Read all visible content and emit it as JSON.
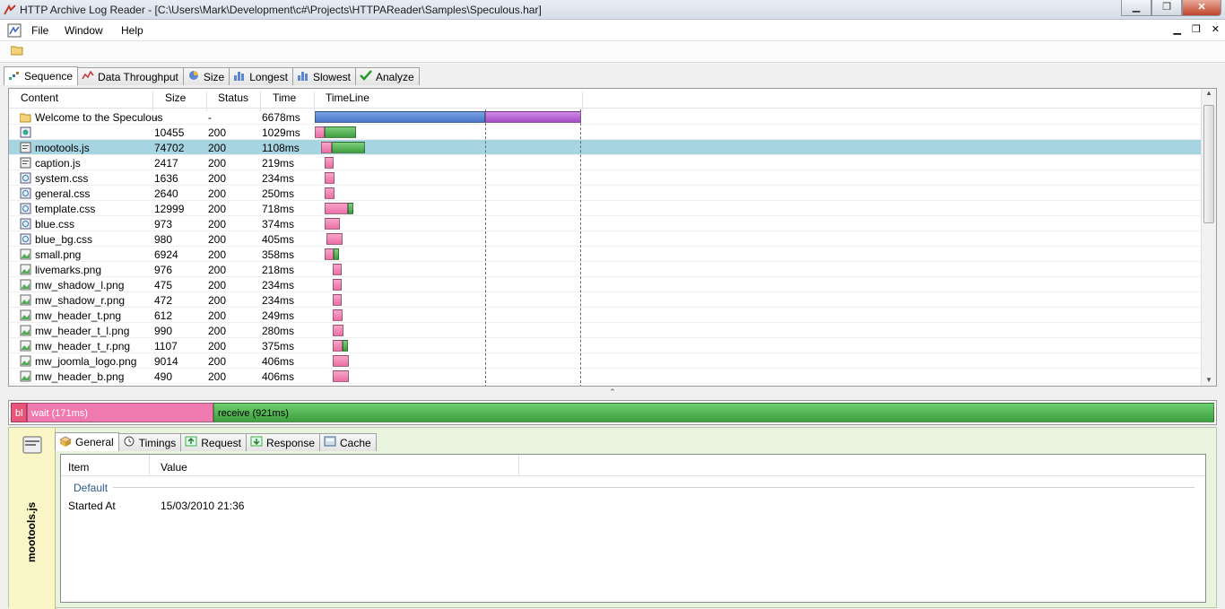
{
  "window": {
    "title": "HTTP Archive Log Reader - [C:\\Users\\Mark\\Development\\c#\\Projects\\HTTPAReader\\Samples\\Speculous.har]"
  },
  "menu": {
    "file": "File",
    "window": "Window",
    "help": "Help"
  },
  "main_tabs": [
    {
      "label": "Sequence",
      "icon": "sequence-icon"
    },
    {
      "label": "Data Throughput",
      "icon": "throughput-icon"
    },
    {
      "label": "Size",
      "icon": "pie-icon"
    },
    {
      "label": "Longest",
      "icon": "bar-chart-icon"
    },
    {
      "label": "Slowest",
      "icon": "bar-chart-icon"
    },
    {
      "label": "Analyze",
      "icon": "checkmark-icon"
    }
  ],
  "grid": {
    "columns": [
      "Content",
      "Size",
      "Status",
      "Time",
      "TimeLine"
    ],
    "rows": [
      {
        "name": "Welcome to the Speculous",
        "size": "-",
        "status": "-",
        "time": "6678ms",
        "icon": "folder",
        "ms": 6678
      },
      {
        "name": "",
        "size": "10455",
        "status": "200",
        "time": "1029ms",
        "icon": "html",
        "ms": 1029
      },
      {
        "name": "mootools.js",
        "size": "74702",
        "status": "200",
        "time": "1108ms",
        "icon": "js",
        "ms": 1108,
        "selected": true
      },
      {
        "name": "caption.js",
        "size": "2417",
        "status": "200",
        "time": "219ms",
        "icon": "js",
        "ms": 219
      },
      {
        "name": "system.css",
        "size": "1636",
        "status": "200",
        "time": "234ms",
        "icon": "css",
        "ms": 234
      },
      {
        "name": "general.css",
        "size": "2640",
        "status": "200",
        "time": "250ms",
        "icon": "css",
        "ms": 250
      },
      {
        "name": "template.css",
        "size": "12999",
        "status": "200",
        "time": "718ms",
        "icon": "css",
        "ms": 718
      },
      {
        "name": "blue.css",
        "size": "973",
        "status": "200",
        "time": "374ms",
        "icon": "css",
        "ms": 374
      },
      {
        "name": "blue_bg.css",
        "size": "980",
        "status": "200",
        "time": "405ms",
        "icon": "css",
        "ms": 405
      },
      {
        "name": "small.png",
        "size": "6924",
        "status": "200",
        "time": "358ms",
        "icon": "png",
        "ms": 358
      },
      {
        "name": "livemarks.png",
        "size": "976",
        "status": "200",
        "time": "218ms",
        "icon": "png",
        "ms": 218
      },
      {
        "name": "mw_shadow_l.png",
        "size": "475",
        "status": "200",
        "time": "234ms",
        "icon": "png",
        "ms": 234
      },
      {
        "name": "mw_shadow_r.png",
        "size": "472",
        "status": "200",
        "time": "234ms",
        "icon": "png",
        "ms": 234
      },
      {
        "name": "mw_header_t.png",
        "size": "612",
        "status": "200",
        "time": "249ms",
        "icon": "png",
        "ms": 249
      },
      {
        "name": "mw_header_t_l.png",
        "size": "990",
        "status": "200",
        "time": "280ms",
        "icon": "png",
        "ms": 280
      },
      {
        "name": "mw_header_t_r.png",
        "size": "1107",
        "status": "200",
        "time": "375ms",
        "icon": "png",
        "ms": 375
      },
      {
        "name": "mw_joomla_logo.png",
        "size": "9014",
        "status": "200",
        "time": "406ms",
        "icon": "png",
        "ms": 406
      },
      {
        "name": "mw_header_b.png",
        "size": "490",
        "status": "200",
        "time": "406ms",
        "icon": "png",
        "ms": 406
      }
    ]
  },
  "timeline_bar": {
    "blocked_label": "bl",
    "wait_label": "wait (171ms)",
    "receive_label": "receive (921ms)"
  },
  "selected_item": {
    "name": "mootools.js"
  },
  "detail_tabs": [
    {
      "label": "General",
      "icon": "cube-icon"
    },
    {
      "label": "Timings",
      "icon": "clock-icon"
    },
    {
      "label": "Request",
      "icon": "upload-icon"
    },
    {
      "label": "Response",
      "icon": "download-icon"
    },
    {
      "label": "Cache",
      "icon": "cache-icon"
    }
  ],
  "properties": {
    "columns": [
      "Item",
      "Value"
    ],
    "category": "Default",
    "rows": [
      {
        "item": "Started At",
        "value": "15/03/2010 21:36"
      }
    ]
  },
  "colors": {
    "accent_selected": "#a7d4e1",
    "wait": "#f07ab0",
    "receive": "#5cb85c",
    "page_blue": "#5b86d6",
    "page_purple": "#b85cd6"
  }
}
